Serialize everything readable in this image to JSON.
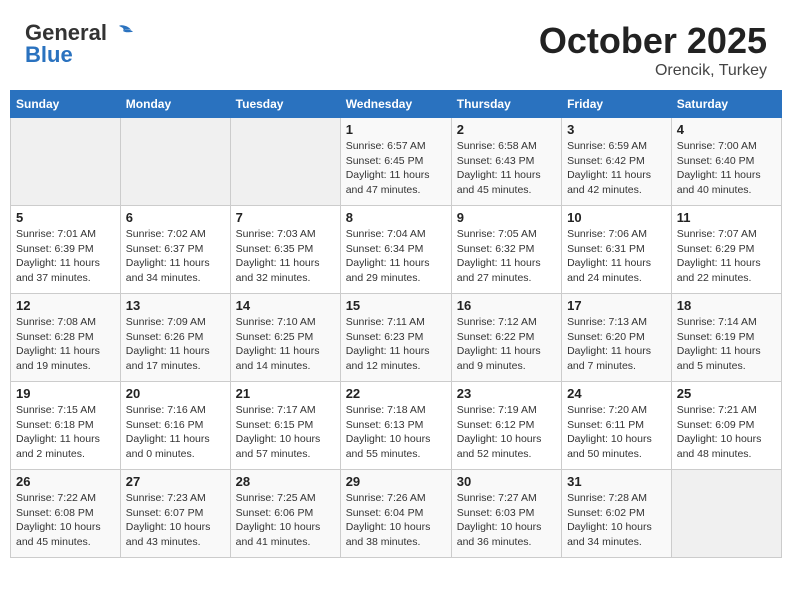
{
  "header": {
    "logo_general": "General",
    "logo_blue": "Blue",
    "month": "October 2025",
    "location": "Orencik, Turkey"
  },
  "weekdays": [
    "Sunday",
    "Monday",
    "Tuesday",
    "Wednesday",
    "Thursday",
    "Friday",
    "Saturday"
  ],
  "weeks": [
    [
      {
        "day": "",
        "info": ""
      },
      {
        "day": "",
        "info": ""
      },
      {
        "day": "",
        "info": ""
      },
      {
        "day": "1",
        "info": "Sunrise: 6:57 AM\nSunset: 6:45 PM\nDaylight: 11 hours and 47 minutes."
      },
      {
        "day": "2",
        "info": "Sunrise: 6:58 AM\nSunset: 6:43 PM\nDaylight: 11 hours and 45 minutes."
      },
      {
        "day": "3",
        "info": "Sunrise: 6:59 AM\nSunset: 6:42 PM\nDaylight: 11 hours and 42 minutes."
      },
      {
        "day": "4",
        "info": "Sunrise: 7:00 AM\nSunset: 6:40 PM\nDaylight: 11 hours and 40 minutes."
      }
    ],
    [
      {
        "day": "5",
        "info": "Sunrise: 7:01 AM\nSunset: 6:39 PM\nDaylight: 11 hours and 37 minutes."
      },
      {
        "day": "6",
        "info": "Sunrise: 7:02 AM\nSunset: 6:37 PM\nDaylight: 11 hours and 34 minutes."
      },
      {
        "day": "7",
        "info": "Sunrise: 7:03 AM\nSunset: 6:35 PM\nDaylight: 11 hours and 32 minutes."
      },
      {
        "day": "8",
        "info": "Sunrise: 7:04 AM\nSunset: 6:34 PM\nDaylight: 11 hours and 29 minutes."
      },
      {
        "day": "9",
        "info": "Sunrise: 7:05 AM\nSunset: 6:32 PM\nDaylight: 11 hours and 27 minutes."
      },
      {
        "day": "10",
        "info": "Sunrise: 7:06 AM\nSunset: 6:31 PM\nDaylight: 11 hours and 24 minutes."
      },
      {
        "day": "11",
        "info": "Sunrise: 7:07 AM\nSunset: 6:29 PM\nDaylight: 11 hours and 22 minutes."
      }
    ],
    [
      {
        "day": "12",
        "info": "Sunrise: 7:08 AM\nSunset: 6:28 PM\nDaylight: 11 hours and 19 minutes."
      },
      {
        "day": "13",
        "info": "Sunrise: 7:09 AM\nSunset: 6:26 PM\nDaylight: 11 hours and 17 minutes."
      },
      {
        "day": "14",
        "info": "Sunrise: 7:10 AM\nSunset: 6:25 PM\nDaylight: 11 hours and 14 minutes."
      },
      {
        "day": "15",
        "info": "Sunrise: 7:11 AM\nSunset: 6:23 PM\nDaylight: 11 hours and 12 minutes."
      },
      {
        "day": "16",
        "info": "Sunrise: 7:12 AM\nSunset: 6:22 PM\nDaylight: 11 hours and 9 minutes."
      },
      {
        "day": "17",
        "info": "Sunrise: 7:13 AM\nSunset: 6:20 PM\nDaylight: 11 hours and 7 minutes."
      },
      {
        "day": "18",
        "info": "Sunrise: 7:14 AM\nSunset: 6:19 PM\nDaylight: 11 hours and 5 minutes."
      }
    ],
    [
      {
        "day": "19",
        "info": "Sunrise: 7:15 AM\nSunset: 6:18 PM\nDaylight: 11 hours and 2 minutes."
      },
      {
        "day": "20",
        "info": "Sunrise: 7:16 AM\nSunset: 6:16 PM\nDaylight: 11 hours and 0 minutes."
      },
      {
        "day": "21",
        "info": "Sunrise: 7:17 AM\nSunset: 6:15 PM\nDaylight: 10 hours and 57 minutes."
      },
      {
        "day": "22",
        "info": "Sunrise: 7:18 AM\nSunset: 6:13 PM\nDaylight: 10 hours and 55 minutes."
      },
      {
        "day": "23",
        "info": "Sunrise: 7:19 AM\nSunset: 6:12 PM\nDaylight: 10 hours and 52 minutes."
      },
      {
        "day": "24",
        "info": "Sunrise: 7:20 AM\nSunset: 6:11 PM\nDaylight: 10 hours and 50 minutes."
      },
      {
        "day": "25",
        "info": "Sunrise: 7:21 AM\nSunset: 6:09 PM\nDaylight: 10 hours and 48 minutes."
      }
    ],
    [
      {
        "day": "26",
        "info": "Sunrise: 7:22 AM\nSunset: 6:08 PM\nDaylight: 10 hours and 45 minutes."
      },
      {
        "day": "27",
        "info": "Sunrise: 7:23 AM\nSunset: 6:07 PM\nDaylight: 10 hours and 43 minutes."
      },
      {
        "day": "28",
        "info": "Sunrise: 7:25 AM\nSunset: 6:06 PM\nDaylight: 10 hours and 41 minutes."
      },
      {
        "day": "29",
        "info": "Sunrise: 7:26 AM\nSunset: 6:04 PM\nDaylight: 10 hours and 38 minutes."
      },
      {
        "day": "30",
        "info": "Sunrise: 7:27 AM\nSunset: 6:03 PM\nDaylight: 10 hours and 36 minutes."
      },
      {
        "day": "31",
        "info": "Sunrise: 7:28 AM\nSunset: 6:02 PM\nDaylight: 10 hours and 34 minutes."
      },
      {
        "day": "",
        "info": ""
      }
    ]
  ]
}
